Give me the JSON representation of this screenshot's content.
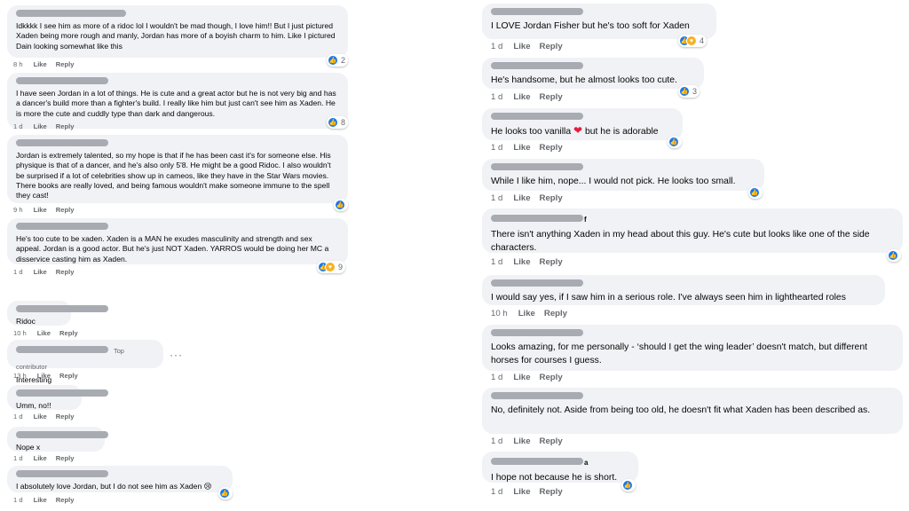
{
  "actions": {
    "like": "Like",
    "reply": "Reply"
  },
  "badges": {
    "top_contributor": "Top contributor"
  },
  "more_label": "···",
  "colors": {
    "bubble": "#f0f2f5",
    "like_blue": "#1877f2",
    "meta_gray": "#65676b"
  },
  "left": [
    {
      "text": "Idkkkk I see him as more of a ridoc lol I wouldn't be mad though, I love him!! But I just pictured Xaden being more rough and manly, Jordan has more of a boyish charm to him. Like I pictured Dain looking somewhat like this",
      "time": "8 h",
      "reactions": "2"
    },
    {
      "text": "I have seen Jordan in a lot of things. He is cute and a great actor but he is not very big and has a dancer's build more than a fighter's build. I really like him but just can't see him as Xaden. He is more the cute and cuddly type than dark and dangerous.",
      "time": "1 d",
      "reactions": "8"
    },
    {
      "text": "Jordan is extremely talented, so my hope is that if he has been cast it's for someone else. His physique is that of a dancer, and he's also only 5'8. He might be a good Ridoc. I also wouldn't be surprised if a lot of celebrities show up in cameos, like they have in the Star Wars movies. There books are really loved, and being famous wouldn't make someone immune to the spell they cast!",
      "time": "9 h",
      "reactions": ""
    },
    {
      "text": "He's too cute to be xaden. Xaden is a MAN he exudes masculinity and strength and sex appeal. Jordan is a good actor. But he's just NOT Xaden. YARROS would be doing her MC a disservice casting him as Xaden.",
      "time": "1 d",
      "reactions": "9"
    },
    {
      "text": "Ridoc",
      "time": "10 h"
    },
    {
      "text": "Interesting",
      "time": "13 h"
    },
    {
      "text": "Umm, no!!",
      "time": "1 d"
    },
    {
      "text": "Nope x",
      "time": "1 d"
    },
    {
      "text": "I absolutely love Jordan, but I do not see him as Xaden 😢",
      "time": "1 d"
    }
  ],
  "right": [
    {
      "text": "I LOVE Jordan Fisher but he's too soft for Xaden",
      "time": "1 d",
      "reactions": "4"
    },
    {
      "text": "He's handsome, but he almost looks too cute.",
      "time": "1 d",
      "reactions": "3"
    },
    {
      "text_before": "He looks too vanilla",
      "text_after": "but he is adorable",
      "time": "1 d"
    },
    {
      "text": "While I like him, nope... I would not pick. He looks too small.",
      "time": "1 d"
    },
    {
      "text": "There isn't anything Xaden in my head about this guy. He's cute but looks like one of the side characters.",
      "time": "1 d",
      "name_suffix": "f"
    },
    {
      "text": "I would say yes, if I saw him in a serious role. I've always seen him in lighthearted roles",
      "time": "10 h"
    },
    {
      "text": "Looks amazing, for me personally - ‘should I get the wing leader’ doesn't match, but different horses for courses I guess.",
      "time": "1 d"
    },
    {
      "text": "No, definitely not. Aside from being too old, he doesn't fit what Xaden has been described as.",
      "time": "1 d"
    },
    {
      "text": "I hope not because he is short.",
      "time": "1 d",
      "name_suffix": "a"
    }
  ]
}
